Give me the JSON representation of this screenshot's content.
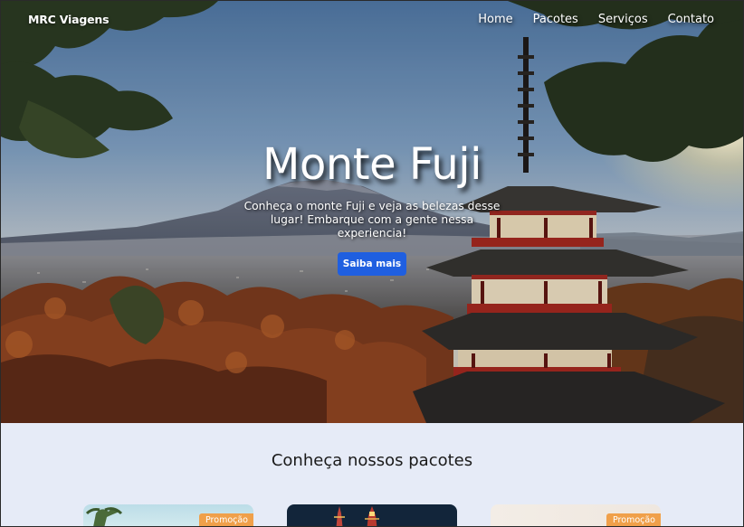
{
  "brand": "MRC Viagens",
  "nav": {
    "items": [
      "Home",
      "Pacotes",
      "Serviços",
      "Contato"
    ]
  },
  "hero": {
    "title": "Monte Fuji",
    "description": "Conheça o monte Fuji e veja as belezas desse lugar! Embarque com a gente nessa experiencia!",
    "button_label": "Saiba mais"
  },
  "packages": {
    "title": "Conheça nossos pacotes",
    "cards": [
      {
        "badge": "Promoção"
      },
      {
        "badge": ""
      },
      {
        "badge": "Promoção"
      }
    ]
  },
  "colors": {
    "accent": "#1f5fe0",
    "badge": "#f0a04a",
    "section_bg": "#e6ebf7"
  }
}
